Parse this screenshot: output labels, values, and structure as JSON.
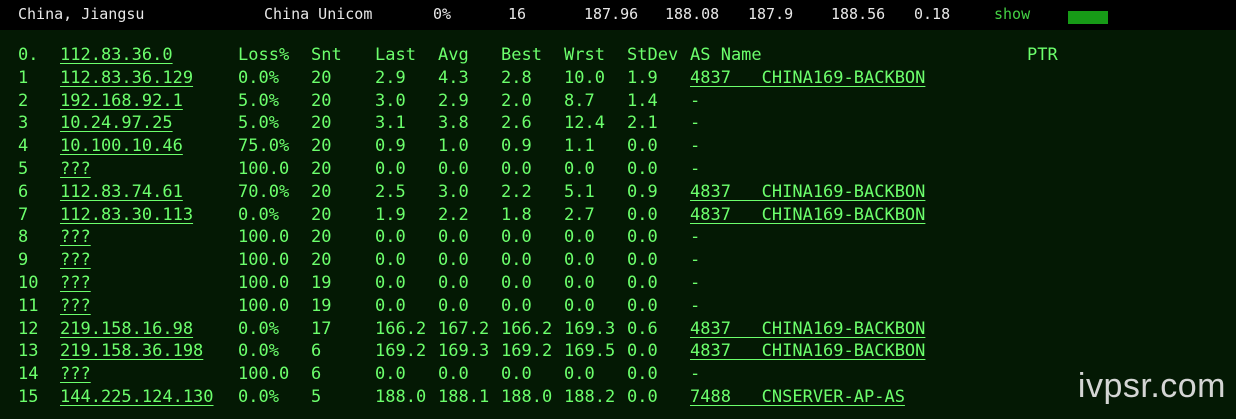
{
  "header": {
    "location": "China, Jiangsu",
    "isp": "China Unicom",
    "loss": "0%",
    "sent": "16",
    "last": "187.96",
    "avg": "188.08",
    "best": "187.9",
    "worst": "188.56",
    "stdev": "0.18",
    "show_label": "show",
    "accent_color": "#179b17"
  },
  "table": {
    "columns": [
      "Loss%",
      "Snt",
      "Last",
      "Avg",
      "Best",
      "Wrst",
      "StDev",
      "AS Name",
      "PTR"
    ],
    "target_index": "0.",
    "target_host": "112.83.36.0",
    "text_color": "#6cff6c",
    "rows": [
      {
        "hop": "1",
        "host": "112.83.36.129",
        "loss": "0.0%",
        "snt": "20",
        "last": "2.9",
        "avg": "4.3",
        "best": "2.8",
        "wrst": "10.0",
        "stdev": "1.9",
        "asname": "4837   CHINA169-BACKBON"
      },
      {
        "hop": "2",
        "host": "192.168.92.1",
        "loss": "5.0%",
        "snt": "20",
        "last": "3.0",
        "avg": "2.9",
        "best": "2.0",
        "wrst": "8.7",
        "stdev": "1.4",
        "asname": "-"
      },
      {
        "hop": "3",
        "host": "10.24.97.25",
        "loss": "5.0%",
        "snt": "20",
        "last": "3.1",
        "avg": "3.8",
        "best": "2.6",
        "wrst": "12.4",
        "stdev": "2.1",
        "asname": "-"
      },
      {
        "hop": "4",
        "host": "10.100.10.46",
        "loss": "75.0%",
        "snt": "20",
        "last": "0.9",
        "avg": "1.0",
        "best": "0.9",
        "wrst": "1.1",
        "stdev": "0.0",
        "asname": "-"
      },
      {
        "hop": "5",
        "host": "???",
        "loss": "100.0",
        "snt": "20",
        "last": "0.0",
        "avg": "0.0",
        "best": "0.0",
        "wrst": "0.0",
        "stdev": "0.0",
        "asname": "-"
      },
      {
        "hop": "6",
        "host": "112.83.74.61",
        "loss": "70.0%",
        "snt": "20",
        "last": "2.5",
        "avg": "3.0",
        "best": "2.2",
        "wrst": "5.1",
        "stdev": "0.9",
        "asname": "4837   CHINA169-BACKBON"
      },
      {
        "hop": "7",
        "host": "112.83.30.113",
        "loss": "0.0%",
        "snt": "20",
        "last": "1.9",
        "avg": "2.2",
        "best": "1.8",
        "wrst": "2.7",
        "stdev": "0.0",
        "asname": "4837   CHINA169-BACKBON"
      },
      {
        "hop": "8",
        "host": "???",
        "loss": "100.0",
        "snt": "20",
        "last": "0.0",
        "avg": "0.0",
        "best": "0.0",
        "wrst": "0.0",
        "stdev": "0.0",
        "asname": "-"
      },
      {
        "hop": "9",
        "host": "???",
        "loss": "100.0",
        "snt": "20",
        "last": "0.0",
        "avg": "0.0",
        "best": "0.0",
        "wrst": "0.0",
        "stdev": "0.0",
        "asname": "-"
      },
      {
        "hop": "10",
        "host": "???",
        "loss": "100.0",
        "snt": "19",
        "last": "0.0",
        "avg": "0.0",
        "best": "0.0",
        "wrst": "0.0",
        "stdev": "0.0",
        "asname": "-"
      },
      {
        "hop": "11",
        "host": "???",
        "loss": "100.0",
        "snt": "19",
        "last": "0.0",
        "avg": "0.0",
        "best": "0.0",
        "wrst": "0.0",
        "stdev": "0.0",
        "asname": "-"
      },
      {
        "hop": "12",
        "host": "219.158.16.98",
        "loss": "0.0%",
        "snt": "17",
        "last": "166.2",
        "avg": "167.2",
        "best": "166.2",
        "wrst": "169.3",
        "stdev": "0.6",
        "asname": "4837   CHINA169-BACKBON"
      },
      {
        "hop": "13",
        "host": "219.158.36.198",
        "loss": "0.0%",
        "snt": "6",
        "last": "169.2",
        "avg": "169.3",
        "best": "169.2",
        "wrst": "169.5",
        "stdev": "0.0",
        "asname": "4837   CHINA169-BACKBON"
      },
      {
        "hop": "14",
        "host": "???",
        "loss": "100.0",
        "snt": "6",
        "last": "0.0",
        "avg": "0.0",
        "best": "0.0",
        "wrst": "0.0",
        "stdev": "0.0",
        "asname": "-"
      },
      {
        "hop": "15",
        "host": "144.225.124.130",
        "loss": "0.0%",
        "snt": "5",
        "last": "188.0",
        "avg": "188.1",
        "best": "188.0",
        "wrst": "188.2",
        "stdev": "0.0",
        "asname": "7488   CNSERVER-AP-AS"
      }
    ]
  },
  "watermark": "ivpsr.com"
}
